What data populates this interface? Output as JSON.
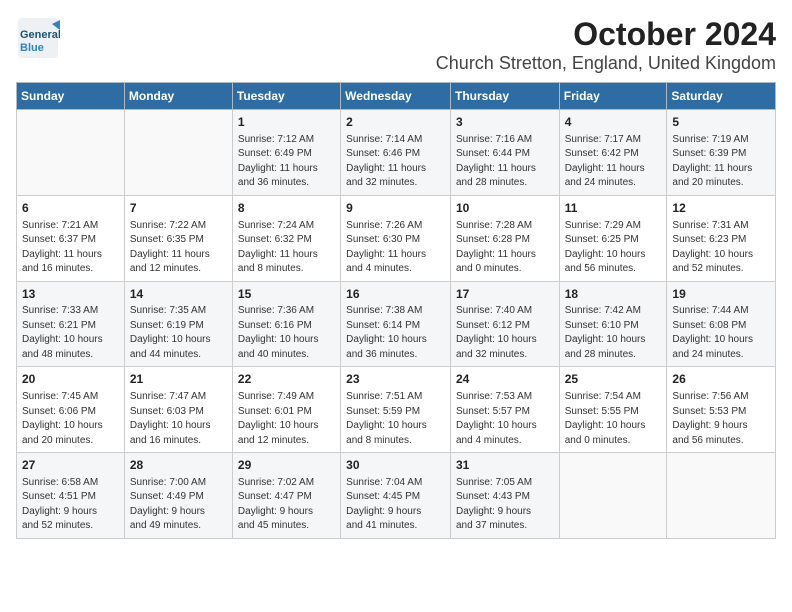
{
  "header": {
    "logo_general": "General",
    "logo_blue": "Blue",
    "month": "October 2024",
    "location": "Church Stretton, England, United Kingdom"
  },
  "days_of_week": [
    "Sunday",
    "Monday",
    "Tuesday",
    "Wednesday",
    "Thursday",
    "Friday",
    "Saturday"
  ],
  "weeks": [
    [
      {
        "day": "",
        "content": ""
      },
      {
        "day": "",
        "content": ""
      },
      {
        "day": "1",
        "content": "Sunrise: 7:12 AM\nSunset: 6:49 PM\nDaylight: 11 hours\nand 36 minutes."
      },
      {
        "day": "2",
        "content": "Sunrise: 7:14 AM\nSunset: 6:46 PM\nDaylight: 11 hours\nand 32 minutes."
      },
      {
        "day": "3",
        "content": "Sunrise: 7:16 AM\nSunset: 6:44 PM\nDaylight: 11 hours\nand 28 minutes."
      },
      {
        "day": "4",
        "content": "Sunrise: 7:17 AM\nSunset: 6:42 PM\nDaylight: 11 hours\nand 24 minutes."
      },
      {
        "day": "5",
        "content": "Sunrise: 7:19 AM\nSunset: 6:39 PM\nDaylight: 11 hours\nand 20 minutes."
      }
    ],
    [
      {
        "day": "6",
        "content": "Sunrise: 7:21 AM\nSunset: 6:37 PM\nDaylight: 11 hours\nand 16 minutes."
      },
      {
        "day": "7",
        "content": "Sunrise: 7:22 AM\nSunset: 6:35 PM\nDaylight: 11 hours\nand 12 minutes."
      },
      {
        "day": "8",
        "content": "Sunrise: 7:24 AM\nSunset: 6:32 PM\nDaylight: 11 hours\nand 8 minutes."
      },
      {
        "day": "9",
        "content": "Sunrise: 7:26 AM\nSunset: 6:30 PM\nDaylight: 11 hours\nand 4 minutes."
      },
      {
        "day": "10",
        "content": "Sunrise: 7:28 AM\nSunset: 6:28 PM\nDaylight: 11 hours\nand 0 minutes."
      },
      {
        "day": "11",
        "content": "Sunrise: 7:29 AM\nSunset: 6:25 PM\nDaylight: 10 hours\nand 56 minutes."
      },
      {
        "day": "12",
        "content": "Sunrise: 7:31 AM\nSunset: 6:23 PM\nDaylight: 10 hours\nand 52 minutes."
      }
    ],
    [
      {
        "day": "13",
        "content": "Sunrise: 7:33 AM\nSunset: 6:21 PM\nDaylight: 10 hours\nand 48 minutes."
      },
      {
        "day": "14",
        "content": "Sunrise: 7:35 AM\nSunset: 6:19 PM\nDaylight: 10 hours\nand 44 minutes."
      },
      {
        "day": "15",
        "content": "Sunrise: 7:36 AM\nSunset: 6:16 PM\nDaylight: 10 hours\nand 40 minutes."
      },
      {
        "day": "16",
        "content": "Sunrise: 7:38 AM\nSunset: 6:14 PM\nDaylight: 10 hours\nand 36 minutes."
      },
      {
        "day": "17",
        "content": "Sunrise: 7:40 AM\nSunset: 6:12 PM\nDaylight: 10 hours\nand 32 minutes."
      },
      {
        "day": "18",
        "content": "Sunrise: 7:42 AM\nSunset: 6:10 PM\nDaylight: 10 hours\nand 28 minutes."
      },
      {
        "day": "19",
        "content": "Sunrise: 7:44 AM\nSunset: 6:08 PM\nDaylight: 10 hours\nand 24 minutes."
      }
    ],
    [
      {
        "day": "20",
        "content": "Sunrise: 7:45 AM\nSunset: 6:06 PM\nDaylight: 10 hours\nand 20 minutes."
      },
      {
        "day": "21",
        "content": "Sunrise: 7:47 AM\nSunset: 6:03 PM\nDaylight: 10 hours\nand 16 minutes."
      },
      {
        "day": "22",
        "content": "Sunrise: 7:49 AM\nSunset: 6:01 PM\nDaylight: 10 hours\nand 12 minutes."
      },
      {
        "day": "23",
        "content": "Sunrise: 7:51 AM\nSunset: 5:59 PM\nDaylight: 10 hours\nand 8 minutes."
      },
      {
        "day": "24",
        "content": "Sunrise: 7:53 AM\nSunset: 5:57 PM\nDaylight: 10 hours\nand 4 minutes."
      },
      {
        "day": "25",
        "content": "Sunrise: 7:54 AM\nSunset: 5:55 PM\nDaylight: 10 hours\nand 0 minutes."
      },
      {
        "day": "26",
        "content": "Sunrise: 7:56 AM\nSunset: 5:53 PM\nDaylight: 9 hours\nand 56 minutes."
      }
    ],
    [
      {
        "day": "27",
        "content": "Sunrise: 6:58 AM\nSunset: 4:51 PM\nDaylight: 9 hours\nand 52 minutes."
      },
      {
        "day": "28",
        "content": "Sunrise: 7:00 AM\nSunset: 4:49 PM\nDaylight: 9 hours\nand 49 minutes."
      },
      {
        "day": "29",
        "content": "Sunrise: 7:02 AM\nSunset: 4:47 PM\nDaylight: 9 hours\nand 45 minutes."
      },
      {
        "day": "30",
        "content": "Sunrise: 7:04 AM\nSunset: 4:45 PM\nDaylight: 9 hours\nand 41 minutes."
      },
      {
        "day": "31",
        "content": "Sunrise: 7:05 AM\nSunset: 4:43 PM\nDaylight: 9 hours\nand 37 minutes."
      },
      {
        "day": "",
        "content": ""
      },
      {
        "day": "",
        "content": ""
      }
    ]
  ]
}
